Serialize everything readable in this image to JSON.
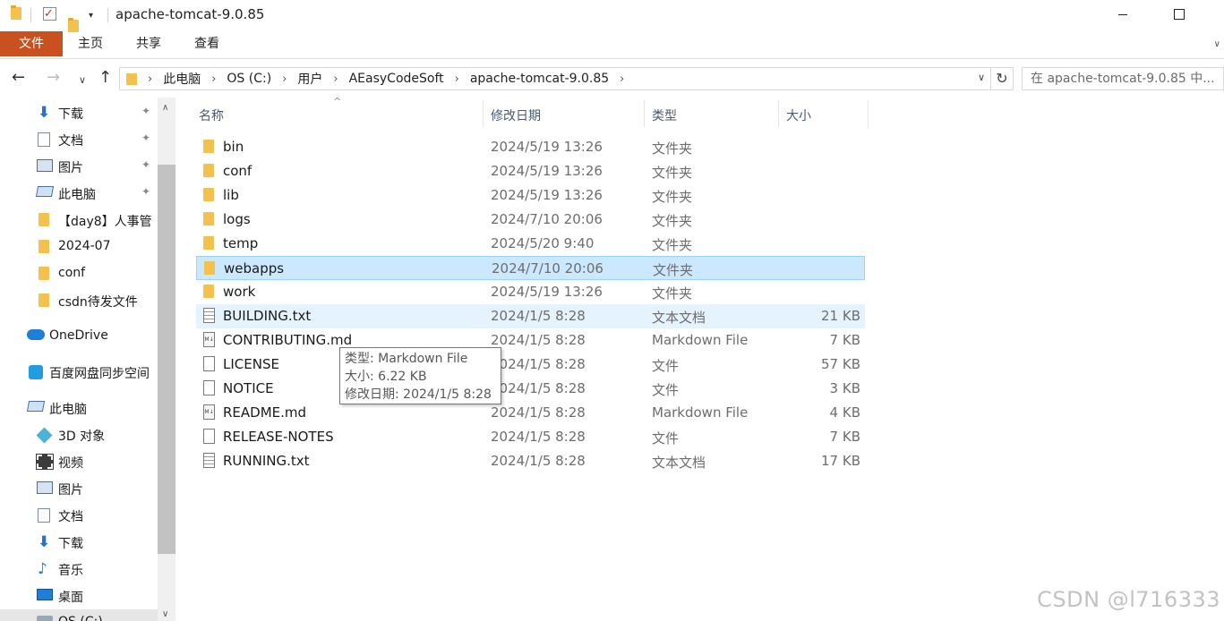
{
  "window": {
    "title": "apache-tomcat-9.0.85",
    "quick_access_check": "✓",
    "quick_access_drop": "▾",
    "minimize": "",
    "maximize": ""
  },
  "ribbon": {
    "tabs": [
      "文件",
      "主页",
      "共享",
      "查看"
    ]
  },
  "nav": {
    "back": "←",
    "forward": "→",
    "recent": "∨",
    "up": "↑",
    "breadcrumbs": [
      "此电脑",
      "OS (C:)",
      "用户",
      "AEasyCodeSoft",
      "apache-tomcat-9.0.85"
    ],
    "crumb_separator": "›",
    "refresh": "↻",
    "search_placeholder": "在 apache-tomcat-9.0.85 中..."
  },
  "sidebar": {
    "items": [
      {
        "label": "下载",
        "icon": "download-icon",
        "pinned": true
      },
      {
        "label": "文档",
        "icon": "document-icon",
        "pinned": true
      },
      {
        "label": "图片",
        "icon": "pictures-icon",
        "pinned": true
      },
      {
        "label": "此电脑",
        "icon": "computer-icon",
        "pinned": true
      },
      {
        "label": "【day8】人事管",
        "icon": "folder-icon",
        "pinned": false
      },
      {
        "label": "2024-07",
        "icon": "folder-icon",
        "pinned": false
      },
      {
        "label": "conf",
        "icon": "folder-icon",
        "pinned": false
      },
      {
        "label": "csdn待发文件",
        "icon": "folder-icon",
        "pinned": false
      },
      {
        "label": "OneDrive",
        "icon": "onedrive-icon",
        "pinned": false
      },
      {
        "label": "百度网盘同步空间",
        "icon": "baidu-netdisk-icon",
        "pinned": false
      },
      {
        "label": "此电脑",
        "icon": "computer-icon",
        "pinned": false
      },
      {
        "label": "3D 对象",
        "icon": "3d-objects-icon",
        "pinned": false
      },
      {
        "label": "视频",
        "icon": "videos-icon",
        "pinned": false
      },
      {
        "label": "图片",
        "icon": "pictures-icon",
        "pinned": false
      },
      {
        "label": "文档",
        "icon": "document-icon",
        "pinned": false
      },
      {
        "label": "下载",
        "icon": "download-icon",
        "pinned": false
      },
      {
        "label": "音乐",
        "icon": "music-icon",
        "pinned": false
      },
      {
        "label": "桌面",
        "icon": "desktop-icon",
        "pinned": false
      },
      {
        "label": "OS (C:)",
        "icon": "drive-icon",
        "pinned": false
      }
    ],
    "pin_glyph": "📌"
  },
  "columns": {
    "name": "名称",
    "date": "修改日期",
    "type": "类型",
    "size": "大小",
    "sort_glyph": "^"
  },
  "files": [
    {
      "name": "bin",
      "date": "2024/5/19 13:26",
      "type": "文件夹",
      "size": "",
      "kind": "folder"
    },
    {
      "name": "conf",
      "date": "2024/5/19 13:26",
      "type": "文件夹",
      "size": "",
      "kind": "folder"
    },
    {
      "name": "lib",
      "date": "2024/5/19 13:26",
      "type": "文件夹",
      "size": "",
      "kind": "folder"
    },
    {
      "name": "logs",
      "date": "2024/7/10 20:06",
      "type": "文件夹",
      "size": "",
      "kind": "folder"
    },
    {
      "name": "temp",
      "date": "2024/5/20 9:40",
      "type": "文件夹",
      "size": "",
      "kind": "folder"
    },
    {
      "name": "webapps",
      "date": "2024/7/10 20:06",
      "type": "文件夹",
      "size": "",
      "kind": "folder"
    },
    {
      "name": "work",
      "date": "2024/5/19 13:26",
      "type": "文件夹",
      "size": "",
      "kind": "folder"
    },
    {
      "name": "BUILDING.txt",
      "date": "2024/1/5 8:28",
      "type": "文本文档",
      "size": "21 KB",
      "kind": "txt"
    },
    {
      "name": "CONTRIBUTING.md",
      "date": "2024/1/5 8:28",
      "type": "Markdown File",
      "size": "7 KB",
      "kind": "md"
    },
    {
      "name": "LICENSE",
      "date": "2024/1/5 8:28",
      "type": "文件",
      "size": "57 KB",
      "kind": "file"
    },
    {
      "name": "NOTICE",
      "date": "2024/1/5 8:28",
      "type": "文件",
      "size": "3 KB",
      "kind": "file"
    },
    {
      "name": "README.md",
      "date": "2024/1/5 8:28",
      "type": "Markdown File",
      "size": "4 KB",
      "kind": "md"
    },
    {
      "name": "RELEASE-NOTES",
      "date": "2024/1/5 8:28",
      "type": "文件",
      "size": "7 KB",
      "kind": "file"
    },
    {
      "name": "RUNNING.txt",
      "date": "2024/1/5 8:28",
      "type": "文本文档",
      "size": "17 KB",
      "kind": "txt"
    }
  ],
  "selected_file": "webapps",
  "hovered_file": "BUILDING.txt",
  "md_icon_text": "M↓",
  "tooltip": {
    "type_line": "类型: Markdown File",
    "size_line": "大小: 6.22 KB",
    "date_line": "修改日期: 2024/1/5 8:28"
  },
  "watermark": "CSDN @l716333",
  "colors": {
    "file_tab": "#c8511f",
    "selection": "#cce8ff",
    "hover": "#e5f3ff",
    "folder": "#f2c14e"
  }
}
